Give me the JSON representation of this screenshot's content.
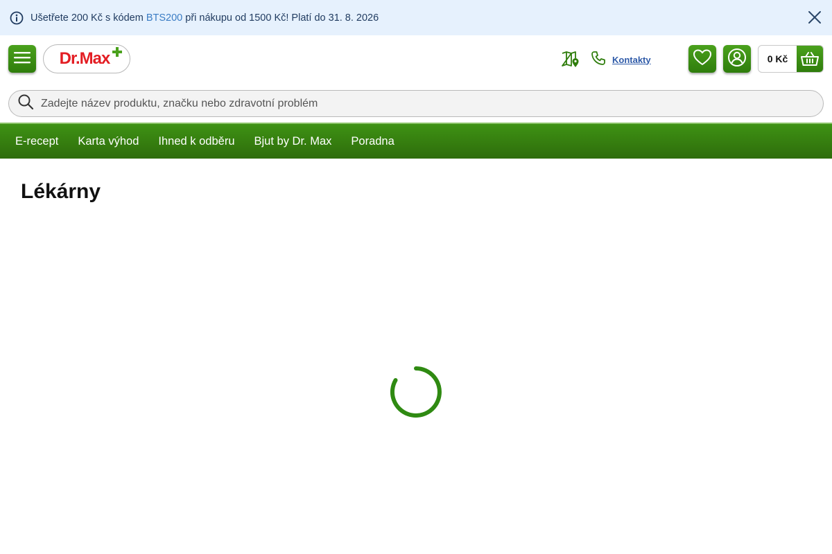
{
  "promo": {
    "text_before": "Ušetřete 200 Kč s kódem ",
    "code": "BTS200",
    "text_after": " při nákupu od 1500 Kč! Platí do 31. 8. 2026"
  },
  "header": {
    "logo_text": "Dr.Max",
    "contact_label": "Kontakty",
    "cart_amount": "0 Kč"
  },
  "search": {
    "placeholder": "Zadejte název produktu, značku nebo zdravotní problém"
  },
  "nav": {
    "items": [
      {
        "label": "E-recept"
      },
      {
        "label": "Karta výhod"
      },
      {
        "label": "Ihned k odběru"
      },
      {
        "label": "Bjut by Dr. Max"
      },
      {
        "label": "Poradna"
      }
    ]
  },
  "main": {
    "title": "Lékárny"
  },
  "icons": {
    "info": "info-icon",
    "close": "close-icon",
    "menu": "hamburger-icon",
    "map": "map-pin-icon",
    "phone": "phone-icon",
    "wishlist": "heart-icon",
    "account": "user-icon",
    "cart": "basket-icon",
    "search": "search-icon",
    "loading": "spinner-icon"
  },
  "colors": {
    "brand_green": "#3e9214",
    "brand_red": "#e31e24",
    "promo_bg": "#e6f1fd",
    "link_blue": "#2e5aa8"
  }
}
